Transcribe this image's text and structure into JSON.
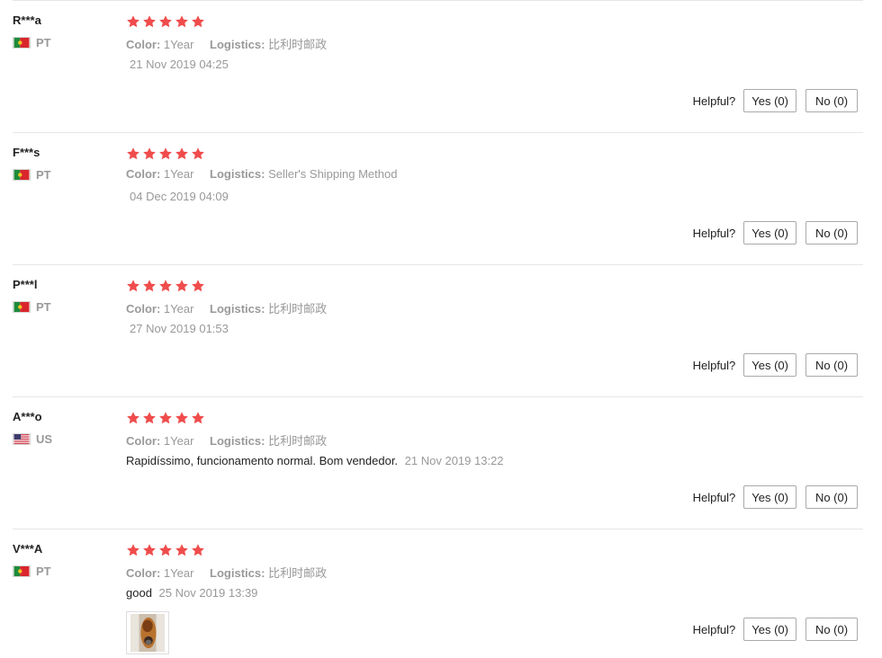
{
  "helpful_label": "Helpful?",
  "colors": {
    "star": "#f04c4c",
    "muted": "#999999",
    "border": "#e6e6e6"
  },
  "reviews": [
    {
      "user": "R***a",
      "country": "PT",
      "flag_icon": "portugal-flag-icon",
      "rating": 5,
      "color_label": "Color:",
      "color_value": "1Year",
      "logistics_label": "Logistics:",
      "logistics_value": "比利时邮政",
      "text": "",
      "date": "21 Nov 2019 04:25",
      "yes": "Yes (0)",
      "no": "No (0)"
    },
    {
      "user": "F***s",
      "country": "PT",
      "flag_icon": "portugal-flag-icon",
      "rating": 5,
      "color_label": "Color:",
      "color_value": "1Year",
      "logistics_label": "Logistics:",
      "logistics_value": "Seller's Shipping Method",
      "text": "",
      "date": "04 Dec 2019 04:09",
      "yes": "Yes (0)",
      "no": "No (0)"
    },
    {
      "user": "P***l",
      "country": "PT",
      "flag_icon": "portugal-flag-icon",
      "rating": 5,
      "color_label": "Color:",
      "color_value": "1Year",
      "logistics_label": "Logistics:",
      "logistics_value": "比利时邮政",
      "text": "",
      "date": "27 Nov 2019 01:53",
      "yes": "Yes (0)",
      "no": "No (0)"
    },
    {
      "user": "A***o",
      "country": "US",
      "flag_icon": "usa-flag-icon",
      "rating": 5,
      "color_label": "Color:",
      "color_value": "1Year",
      "logistics_label": "Logistics:",
      "logistics_value": "比利时邮政",
      "text": "Rapidíssimo, funcionamento normal. Bom vendedor.",
      "date": "21 Nov 2019 13:22",
      "yes": "Yes (0)",
      "no": "No (0)"
    },
    {
      "user": "V***A",
      "country": "PT",
      "flag_icon": "portugal-flag-icon",
      "rating": 5,
      "color_label": "Color:",
      "color_value": "1Year",
      "logistics_label": "Logistics:",
      "logistics_value": "比利时邮政",
      "text": "good",
      "date": "25 Nov 2019 13:39",
      "photo_icon": "review-photo-thumbnail",
      "yes": "Yes (0)",
      "no": "No (0)"
    }
  ]
}
